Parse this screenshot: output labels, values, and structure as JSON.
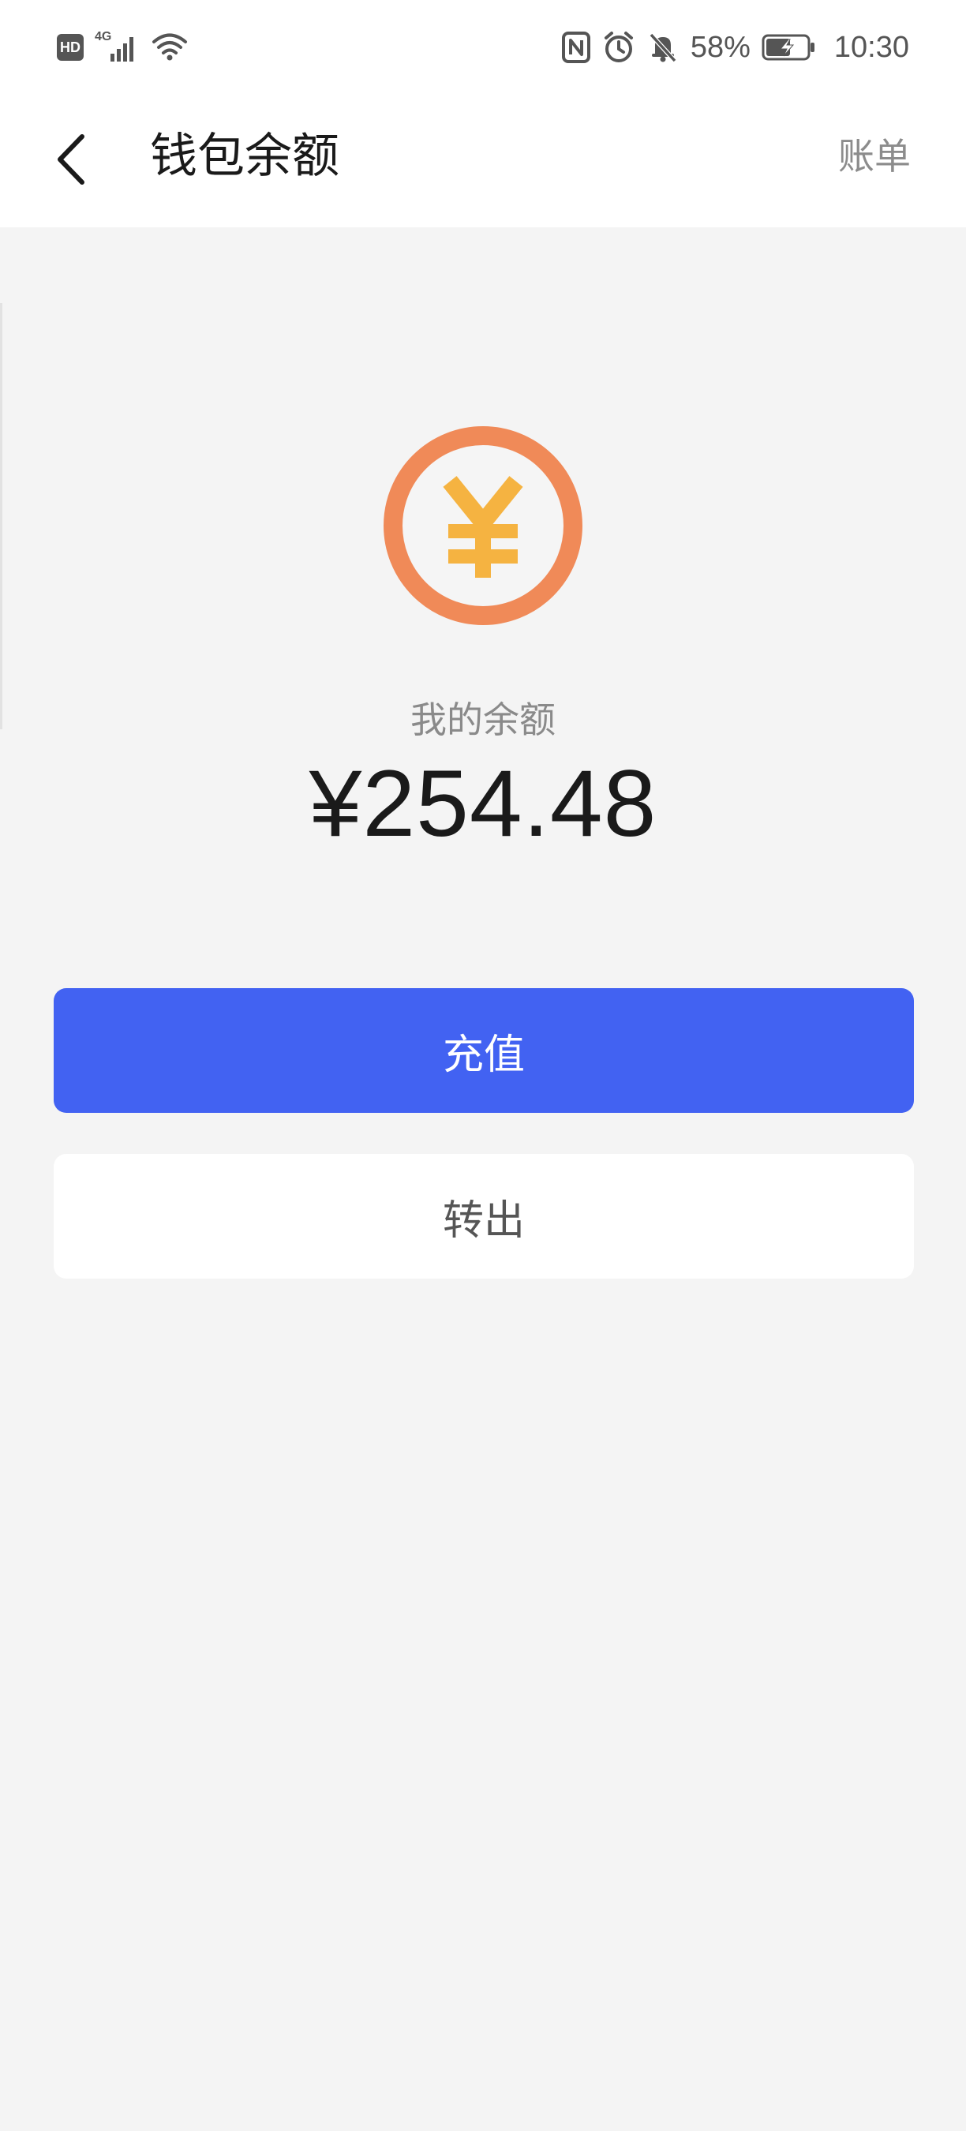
{
  "status_bar": {
    "hd_label": "HD",
    "network_type": "4G",
    "battery_percent": "58%",
    "time": "10:30",
    "icons": [
      "signal-icon",
      "wifi-icon",
      "nfc-icon",
      "alarm-icon",
      "mute-icon",
      "battery-charging-icon"
    ]
  },
  "header": {
    "back_icon": "chevron-left-icon",
    "title": "钱包余额",
    "bill_link": "账单"
  },
  "balance": {
    "icon": "yuan-coin-icon",
    "label": "我的余额",
    "amount": "¥254.48"
  },
  "actions": {
    "recharge_label": "充值",
    "withdraw_label": "转出"
  },
  "colors": {
    "primary_button": "#4262f2",
    "coin_ring": "#f08a58",
    "coin_symbol": "#f5b341",
    "background": "#f4f4f4"
  }
}
